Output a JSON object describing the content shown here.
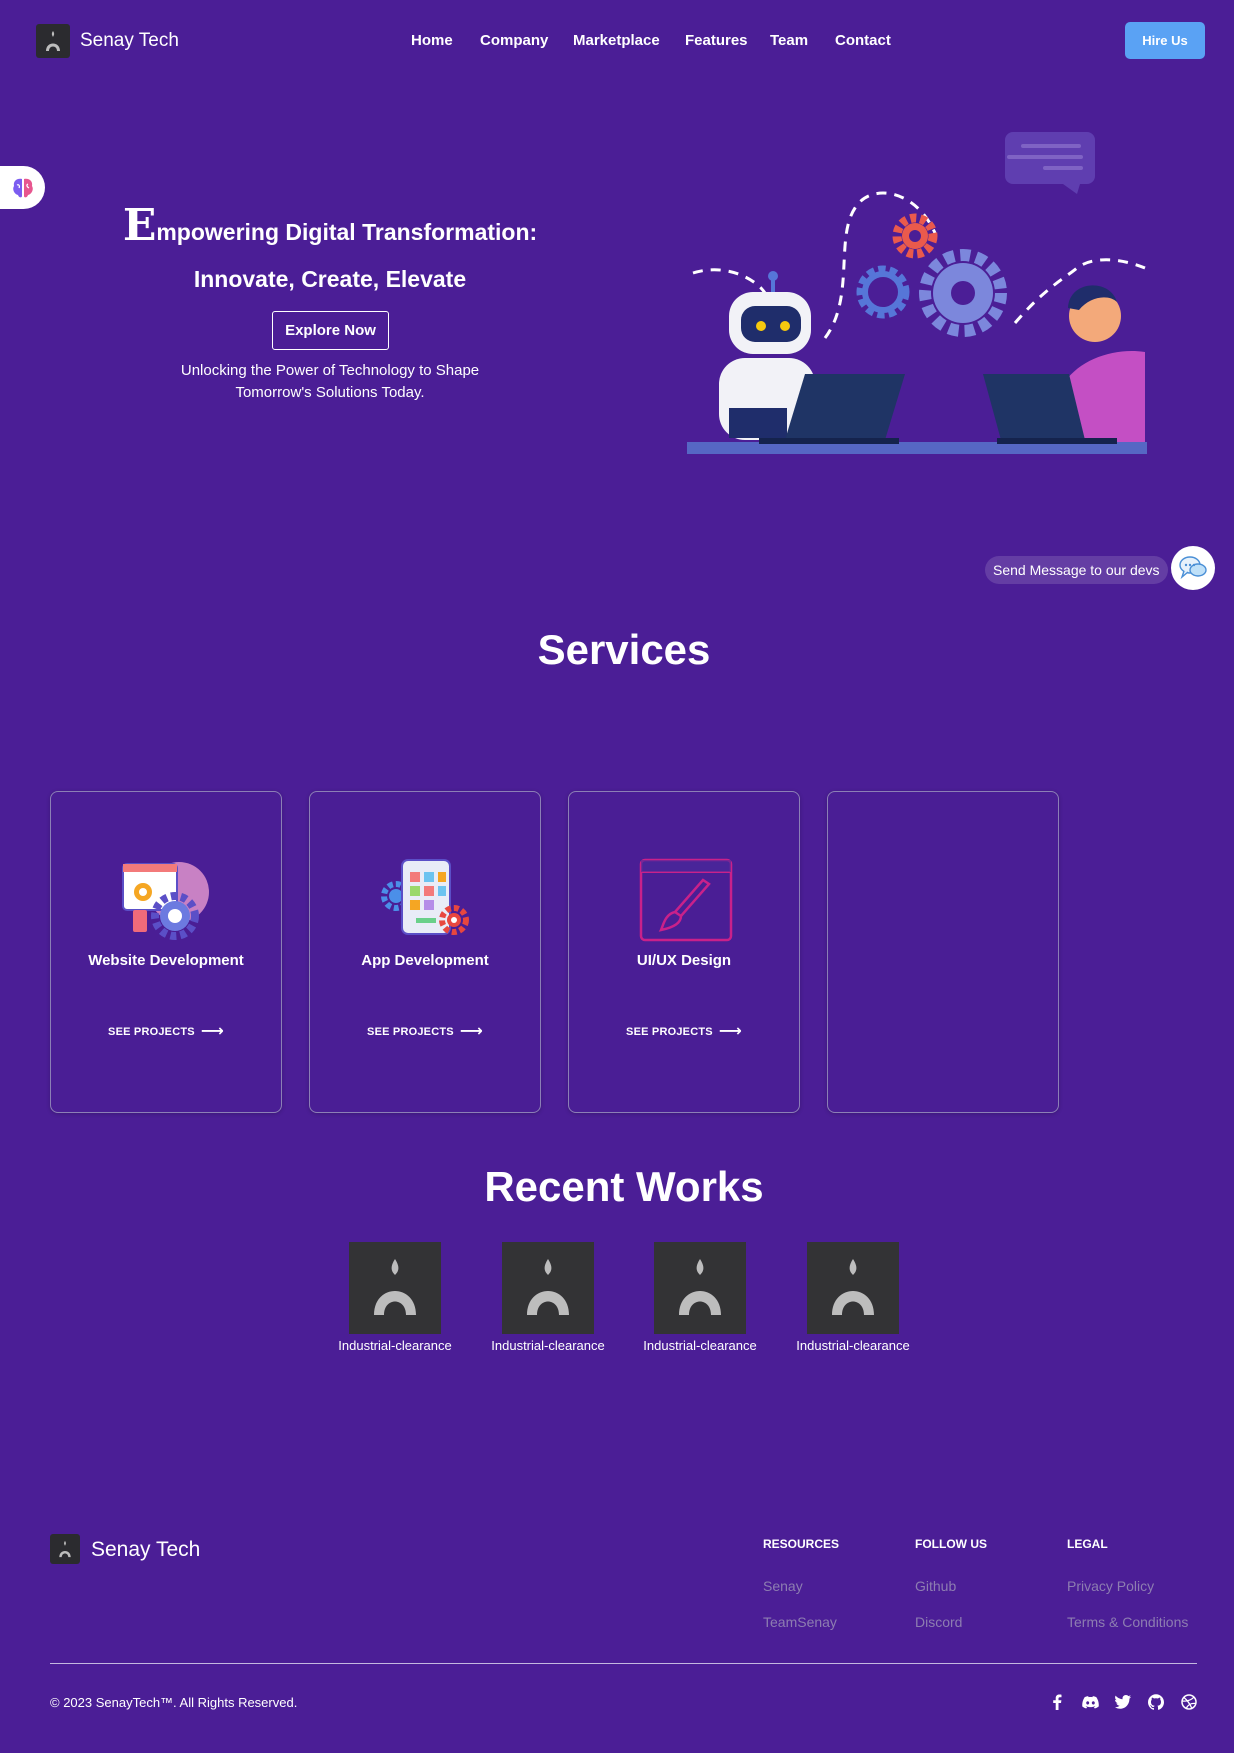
{
  "header": {
    "brand": "Senay Tech",
    "nav": [
      {
        "label": "Home"
      },
      {
        "label": "Company"
      },
      {
        "label": "Marketplace"
      },
      {
        "label": "Features"
      },
      {
        "label": "Team"
      },
      {
        "label": "Contact"
      }
    ],
    "hire_label": "Hire Us"
  },
  "hero": {
    "title_initial": "E",
    "title_rest": "mpowering Digital Transformation:",
    "title_line2": "Innovate, Create, Elevate",
    "cta_label": "Explore Now",
    "subtitle": "Unlocking the Power of Technology to Shape Tomorrow's Solutions Today."
  },
  "chat_widget": {
    "label": "Send Message to our devs"
  },
  "services": {
    "title": "Services",
    "cards": [
      {
        "title": "Website Development",
        "link": "SEE PROJECTS"
      },
      {
        "title": "App Development",
        "link": "SEE PROJECTS"
      },
      {
        "title": "UI/UX Design",
        "link": "SEE PROJECTS"
      },
      {
        "title": "",
        "link": ""
      }
    ]
  },
  "recent_works": {
    "title": "Recent Works",
    "items": [
      {
        "caption": "Industrial-clearance"
      },
      {
        "caption": "Industrial-clearance"
      },
      {
        "caption": "Industrial-clearance"
      },
      {
        "caption": "Industrial-clearance"
      }
    ]
  },
  "footer": {
    "brand": "Senay Tech",
    "columns": [
      {
        "heading": "RESOURCES",
        "links": [
          "Senay",
          "TeamSenay"
        ]
      },
      {
        "heading": "FOLLOW US",
        "links": [
          "Github",
          "Discord"
        ]
      },
      {
        "heading": "LEGAL",
        "links": [
          "Privacy Policy",
          "Terms & Conditions"
        ]
      }
    ],
    "copyright": "© 2023 SenayTech™. All Rights Reserved.",
    "social_icons": [
      "facebook-icon",
      "discord-icon",
      "twitter-icon",
      "github-icon",
      "dribbble-icon"
    ]
  },
  "colors": {
    "background": "#4b1e96",
    "hire_button": "#5aa2f4",
    "footer_link": "#8d7db1"
  }
}
